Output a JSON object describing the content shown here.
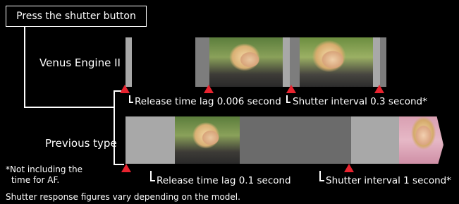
{
  "press_label": "Press the shutter button",
  "row_venus_label": "Venus Engine II",
  "row_previous_label": "Previous type",
  "venus_release_lag": "Release time lag 0.006 second",
  "venus_interval": "Shutter interval 0.3 second*",
  "prev_release_lag": "Release time lag 0.1 second",
  "prev_interval": "Shutter interval 1 second*",
  "note_line1": "*Not including the",
  "note_line2": "time for AF.",
  "footer": "Shutter response figures vary depending on the model.",
  "colors": {
    "marker": "#e8232f",
    "background": "#000000"
  }
}
